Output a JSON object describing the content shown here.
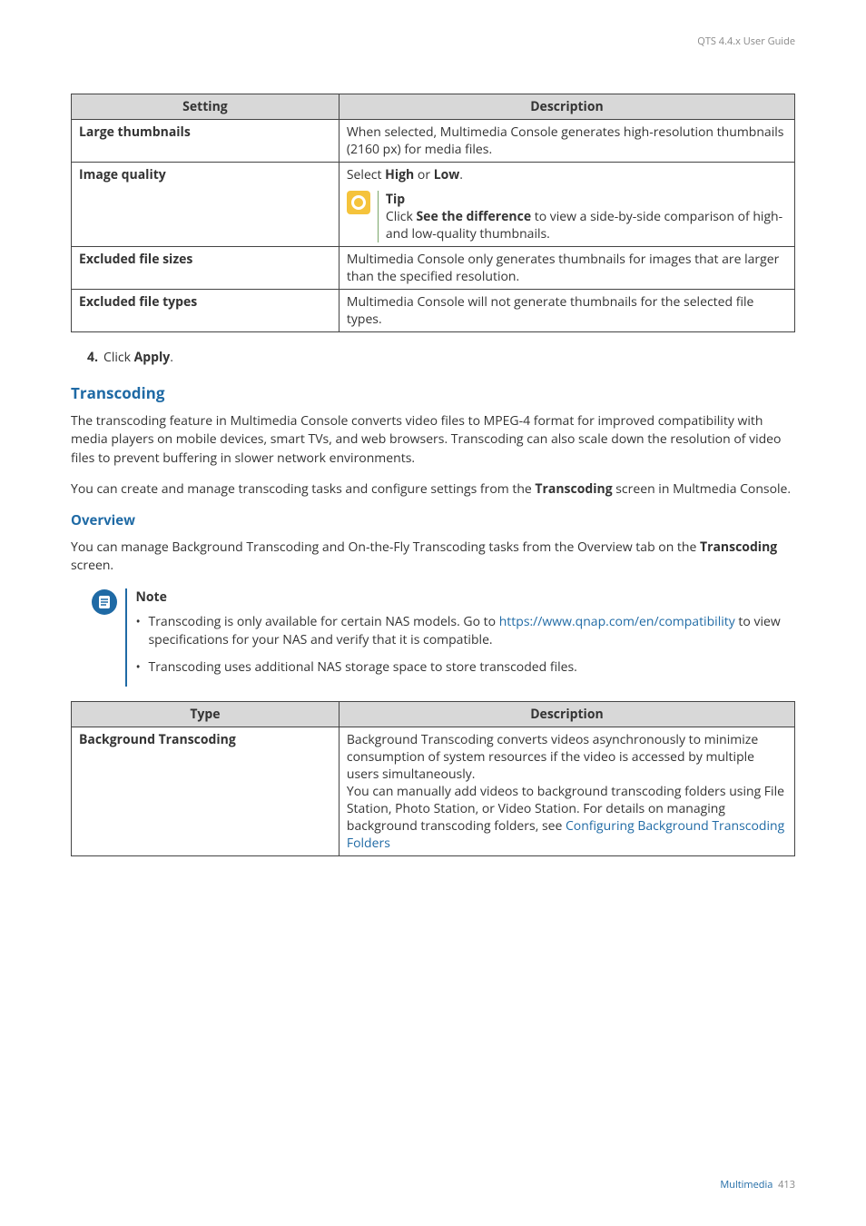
{
  "header": {
    "guide_title": "QTS 4.4.x User Guide"
  },
  "table1": {
    "headers": [
      "Setting",
      "Description"
    ],
    "rows": [
      {
        "setting": "Large thumbnails",
        "description": "When selected, Multimedia Console generates high-resolution thumbnails (2160 px) for media files."
      },
      {
        "setting": "Image quality",
        "desc_lead": "Select ",
        "desc_strong1": "High",
        "desc_mid": " or ",
        "desc_strong2": "Low",
        "desc_tail": ".",
        "tip_label": "Tip",
        "tip_pre": "Click ",
        "tip_bold": "See the difference",
        "tip_post": " to view a side-by-side comparison of high- and low-quality thumbnails."
      },
      {
        "setting": "Excluded file sizes",
        "description": "Multimedia Console only generates thumbnails for images that are larger than the specified resolution."
      },
      {
        "setting": "Excluded file types",
        "description": "Multimedia Console will not generate thumbnails for the selected file types."
      }
    ]
  },
  "step": {
    "num": "4.",
    "pre": "Click ",
    "bold": "Apply",
    "tail": "."
  },
  "transcoding": {
    "heading": "Transcoding",
    "para1": "The transcoding feature in Multimedia Console converts video files to MPEG-4 format for improved compatibility with media players on mobile devices, smart TVs, and web browsers. Transcoding can also scale down the resolution of video files to prevent buffering in slower network environments.",
    "para2_pre": "You can create and manage transcoding tasks and configure settings from the ",
    "para2_bold": "Transcoding",
    "para2_post": " screen in Multmedia Console."
  },
  "overview": {
    "heading": "Overview",
    "para_pre": "You can manage Background Transcoding and On-the-Fly Transcoding tasks from the Overview tab on the ",
    "para_bold": "Transcoding",
    "para_post": " screen."
  },
  "note": {
    "label": "Note",
    "item1_pre": "Transcoding is only available for certain NAS models. Go to ",
    "item1_link": "https://www.qnap.com/en/compatibility",
    "item1_post": " to view specifications for your NAS and verify that it is compatible.",
    "item2": "Transcoding uses additional NAS storage space to store transcoded files."
  },
  "table2": {
    "headers": [
      "Type",
      "Description"
    ],
    "row": {
      "type": "Background Transcoding",
      "desc_main": "Background Transcoding converts videos asynchronously to minimize consumption of system resources if the video is accessed by multiple users simultaneously.\nYou can manually add videos to background transcoding folders using File Station, Photo Station, or Video Station. For details on managing background transcoding folders, see ",
      "desc_link": "Configuring Background Transcoding Folders"
    }
  },
  "footer": {
    "section": "Multimedia",
    "page": "413"
  }
}
